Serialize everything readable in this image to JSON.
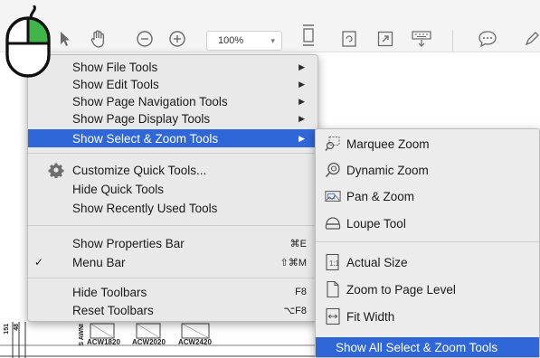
{
  "toolbar": {
    "zoom_value": "100%",
    "icons": [
      "select-arrow-icon",
      "hand-icon",
      "zoom-out-icon",
      "zoom-in-icon",
      "fit-page-icon",
      "rotate-icon",
      "fullscreen-icon",
      "keyboard-icon",
      "comment-icon",
      "pen-icon"
    ]
  },
  "document": {
    "plan_labels": [
      "ACW1820",
      "ACW2020",
      "ACW2420"
    ],
    "side_labels": [
      "151",
      "48",
      "S AWNI"
    ]
  },
  "main_menu": {
    "items": [
      {
        "label": "Show File Tools",
        "submenu": true
      },
      {
        "label": "Show Edit Tools",
        "submenu": true
      },
      {
        "label": "Show Page Navigation Tools",
        "submenu": true
      },
      {
        "label": "Show Page Display Tools",
        "submenu": true
      },
      {
        "label": "Show Select & Zoom Tools",
        "submenu": true,
        "selected": true
      },
      {
        "label": "Customize Quick Tools...",
        "icon": "gear-icon"
      },
      {
        "label": "Hide Quick Tools"
      },
      {
        "label": "Show Recently Used Tools"
      },
      {
        "label": "Show Properties Bar",
        "shortcut": "⌘E"
      },
      {
        "label": "Menu Bar",
        "shortcut": "⇧⌘M",
        "checked": true
      },
      {
        "label": "Hide Toolbars",
        "shortcut": "F8"
      },
      {
        "label": "Reset Toolbars",
        "shortcut": "⌥F8"
      }
    ],
    "check_mark": "✓",
    "arrow": "▶"
  },
  "sub_menu": {
    "items": [
      {
        "label": "Marquee Zoom",
        "icon": "marquee-zoom-icon"
      },
      {
        "label": "Dynamic Zoom",
        "icon": "dynamic-zoom-icon"
      },
      {
        "label": "Pan & Zoom",
        "icon": "pan-zoom-icon"
      },
      {
        "label": "Loupe Tool",
        "icon": "loupe-icon"
      },
      {
        "label": "Actual Size",
        "icon": "actual-size-icon"
      },
      {
        "label": "Zoom to Page Level",
        "icon": "page-icon"
      },
      {
        "label": "Fit Width",
        "icon": "fit-width-icon"
      },
      {
        "label": "Show All Select & Zoom Tools",
        "selected": true
      }
    ]
  },
  "colors": {
    "highlight": "#2f67d8",
    "menu_bg": "#e9e9e9",
    "mouse_button": "#3fb54a"
  }
}
